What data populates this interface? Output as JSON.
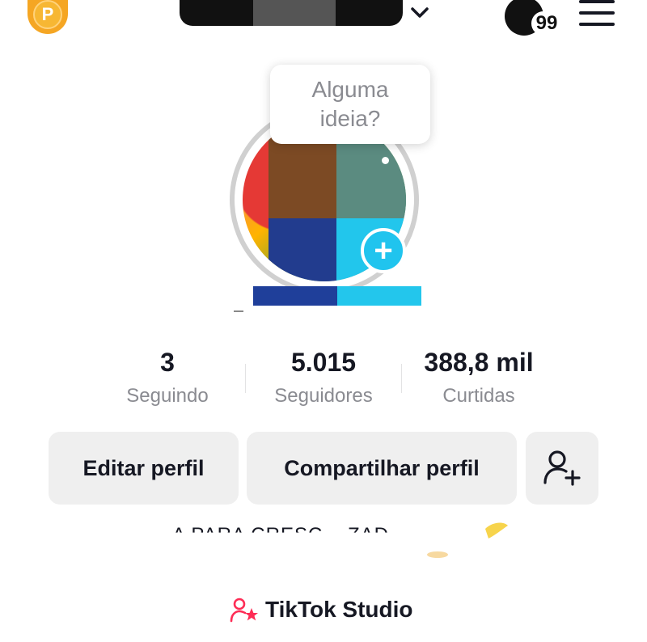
{
  "header": {
    "coin_letter": "P",
    "notifications_count": "99"
  },
  "avatar": {
    "tooltip": "Alguma ideia?"
  },
  "stats": [
    {
      "value": "3",
      "label": "Seguindo"
    },
    {
      "value": "5.015",
      "label": "Seguidores"
    },
    {
      "value": "388,8 mil",
      "label": "Curtidas"
    }
  ],
  "actions": {
    "edit_profile": "Editar perfil",
    "share_profile": "Compartilhar perfil"
  },
  "bio": {
    "text": "...A PARA CRESC... ZAD..."
  },
  "studio": {
    "label": "TikTok Studio"
  },
  "colors": {
    "accent_cyan": "#20c4ee",
    "coin": "#f5a623",
    "studio_icon": "#fe2c55",
    "button_bg": "#efefef",
    "muted_text": "#8a8b91"
  }
}
